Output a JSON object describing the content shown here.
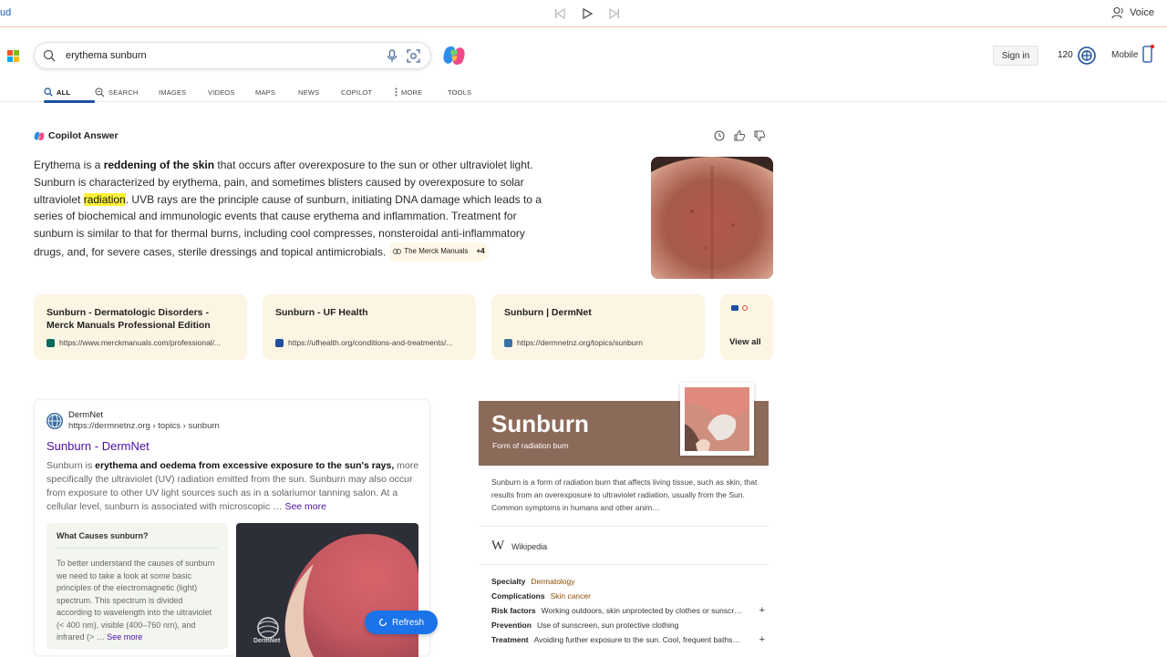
{
  "topbar": {
    "cut_text": "ud",
    "voice_label": "Voice"
  },
  "search": {
    "query": "erythema sunburn"
  },
  "header": {
    "sign_in": "Sign in",
    "points": "120",
    "mobile": "Mobile"
  },
  "tabs": [
    {
      "label": "ALL",
      "icon": "search-icon"
    },
    {
      "label": "SEARCH",
      "icon": "copilot-search-icon"
    },
    {
      "label": "IMAGES"
    },
    {
      "label": "VIDEOS"
    },
    {
      "label": "MAPS"
    },
    {
      "label": "NEWS"
    },
    {
      "label": "COPILOT"
    },
    {
      "label": "MORE",
      "icon": "more-dots-icon"
    },
    {
      "label": "TOOLS"
    }
  ],
  "copilot": {
    "heading": "Copilot Answer",
    "text_1": "Erythema is a ",
    "bold_1": "reddening of the skin",
    "text_2": " that occurs after overexposure to the sun or other ultraviolet light. Sunburn is characterized by erythema, pain, and sometimes blisters caused by overexposure to solar ultraviolet ",
    "highlight": "radiation",
    "text_3": ". UVB rays are the principle cause of sunburn, initiating DNA damage which leads to a series of biochemical and immunologic events that cause erythema and inflammation. Treatment for sunburn is similar to that for thermal burns, including cool compresses, nonsteroidal anti-inflammatory drugs, and, for severe cases, sterile dressings and topical antimicrobials.",
    "citation": "The Merck Manuals",
    "citation_more": "+4"
  },
  "sources": [
    {
      "title": "Sunburn - Dermatologic Disorders - Merck Manuals Professional Edition",
      "url": "https://www.merckmanuals.com/professional/...",
      "color": "#0a6b5a"
    },
    {
      "title": "Sunburn - UF Health",
      "url": "https://ufhealth.org/conditions-and-treatments/...",
      "color": "#1f4f9e"
    },
    {
      "title": "Sunburn | DermNet",
      "url": "https://dermnetnz.org/topics/sunburn",
      "color": "#3b6fa6"
    }
  ],
  "view_all": "View all",
  "result": {
    "site": "DermNet",
    "crumb": "https://dermnetnz.org › topics › sunburn",
    "title": "Sunburn - DermNet",
    "snip_1": "Sunburn is ",
    "snip_bold": "erythema and oedema from excessive exposure to the sun's rays,",
    "snip_2": " more specifically the ultraviolet (UV) radiation emitted from the sun. Sunburn may also occur from exposure to other UV light sources such as in a solariumor tanning salon. At a cellular level, sunburn is associated with microscopic … ",
    "see_more": "See more",
    "qa_heading": "What Causes sunburn?",
    "qa_body": "To better understand the causes of sunburn we need to take a look at some basic principles of the electromagnetic (light) spectrum. This spectrum is divided according to wavelength into the ultraviolet (< 400 nm), visible (400–760 nm), and infrared (> … ",
    "qa_see_more": "See more",
    "img_brand": "DermNet"
  },
  "refresh_label": "Refresh",
  "knowledge": {
    "name": "Sunburn",
    "subtitle": "Form of radiation burn",
    "description": "Sunburn is a form of radiation burn that affects living tissue, such as skin, that results from an overexposure to ultraviolet radiation, usually from the Sun. Common symptoms in humans and other anim…",
    "wiki_label": "Wikipedia",
    "facts": [
      {
        "key": "Specialty",
        "value": "Dermatology",
        "link": true,
        "expand": false
      },
      {
        "key": "Complications",
        "value": "Skin cancer",
        "link": true,
        "expand": false
      },
      {
        "key": "Risk factors",
        "value": "Working outdoors, skin unprotected by clothes or sunscr…",
        "link": false,
        "expand": true
      },
      {
        "key": "Prevention",
        "value": "Use of sunscreen, sun protective clothing",
        "link": false,
        "expand": false
      },
      {
        "key": "Treatment",
        "value": "Avoiding further exposure to the sun. Cool, frequent baths…",
        "link": false,
        "expand": true
      }
    ]
  },
  "colors": {
    "accent": "#1a4fa0",
    "link_visited": "#4c0fa3",
    "source_card_bg": "#fdf5e4",
    "banner": "#8c6a5a",
    "refresh": "#1a73e8"
  }
}
